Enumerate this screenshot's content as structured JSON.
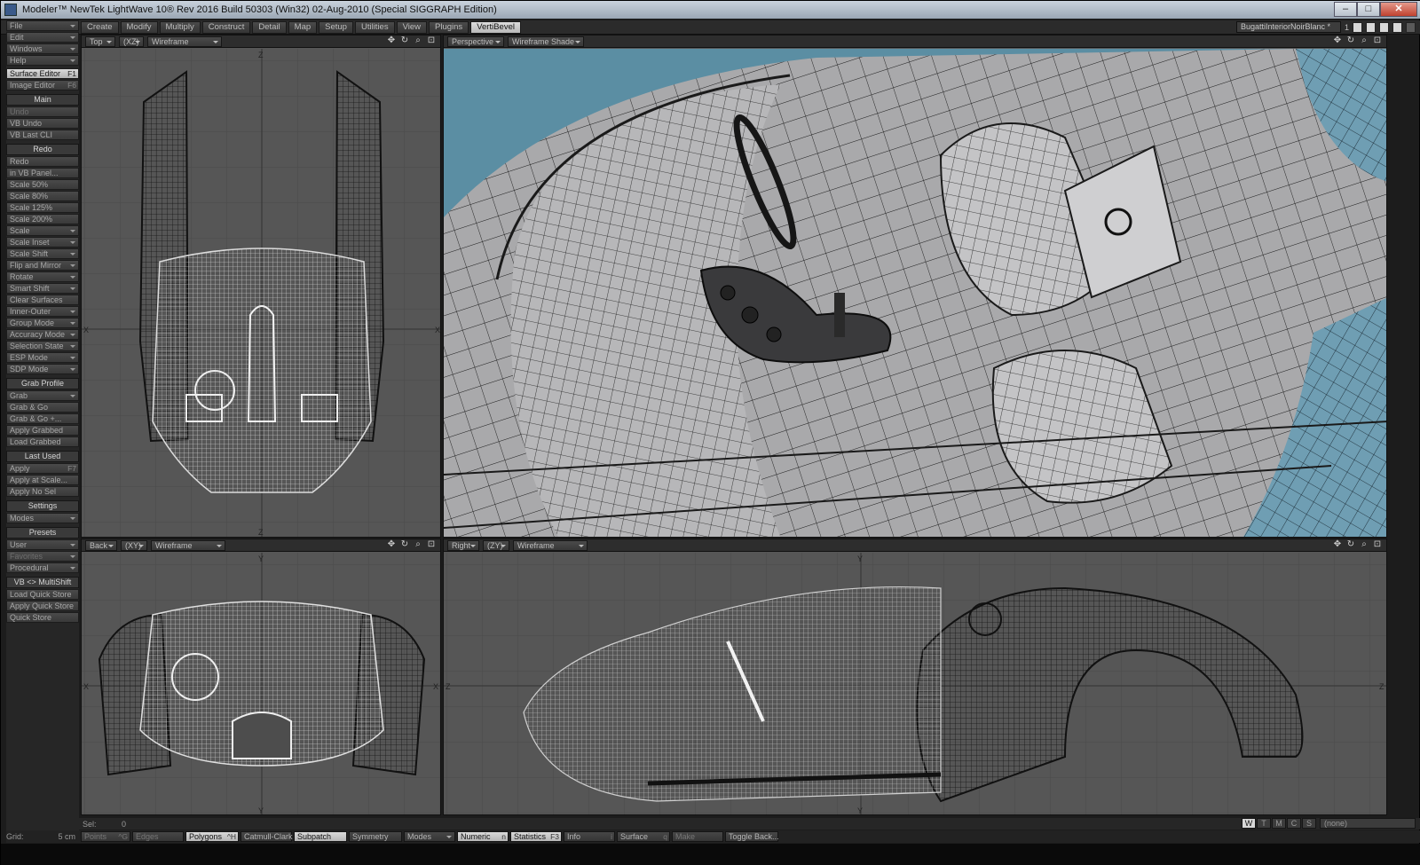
{
  "window": {
    "title": "Modeler™ NewTek LightWave 10® Rev 2016 Build 50303 (Win32) 02-Aug-2010 (Special SIGGRAPH Edition)",
    "minimize": "–",
    "maximize": "□",
    "close": "✕"
  },
  "tabs": [
    "Create",
    "Modify",
    "Multiply",
    "Construct",
    "Detail",
    "Map",
    "Setup",
    "Utilities",
    "View",
    "Plugins",
    "VertiBevel"
  ],
  "active_tab": "VertiBevel",
  "object_selector": "BugattiInteriorNoirBlanc *",
  "layer_number": "1",
  "sidebar": {
    "menus": [
      {
        "label": "File",
        "dd": true
      },
      {
        "label": "Edit",
        "dd": true
      },
      {
        "label": "Windows",
        "dd": true
      },
      {
        "label": "Help",
        "dd": true
      }
    ],
    "editors": [
      {
        "label": "Surface Editor",
        "key": "F1",
        "hl": true
      },
      {
        "label": "Image Editor",
        "key": "F6"
      }
    ],
    "main_head": "Main",
    "main": [
      {
        "label": "Undo",
        "dim": true
      },
      {
        "label": "VB Undo"
      },
      {
        "label": "VB Last CLI"
      }
    ],
    "redo_head": "Redo",
    "redo": [
      {
        "label": "Redo"
      },
      {
        "label": "in VB Panel..."
      },
      {
        "label": "Scale   50%"
      },
      {
        "label": "Scale   80%"
      },
      {
        "label": "Scale 125%"
      },
      {
        "label": "Scale 200%"
      },
      {
        "label": "Scale",
        "dd": true
      },
      {
        "label": "Scale Inset",
        "dd": true
      },
      {
        "label": "Scale Shift",
        "dd": true
      },
      {
        "label": "Flip and Mirror",
        "dd": true
      },
      {
        "label": "Rotate",
        "dd": true
      },
      {
        "label": "Smart Shift",
        "dd": true
      },
      {
        "label": "Clear Surfaces"
      },
      {
        "label": "Inner-Outer",
        "dd": true
      },
      {
        "label": "Group Mode",
        "dd": true
      },
      {
        "label": "Accuracy Mode",
        "dd": true
      },
      {
        "label": "Selection State",
        "dd": true
      },
      {
        "label": "ESP Mode",
        "dd": true
      },
      {
        "label": "SDP Mode",
        "dd": true
      }
    ],
    "grab_head": "Grab Profile",
    "grab": [
      {
        "label": "Grab",
        "dd": true
      },
      {
        "label": "Grab & Go"
      },
      {
        "label": "Grab & Go +..."
      },
      {
        "label": "Apply Grabbed"
      },
      {
        "label": "Load Grabbed"
      }
    ],
    "last_head": "Last Used",
    "last": [
      {
        "label": "Apply",
        "key": "F7"
      },
      {
        "label": "Apply at Scale..."
      },
      {
        "label": "Apply No Sel"
      }
    ],
    "settings_head": "Settings",
    "settings": [
      {
        "label": "Modes",
        "dd": true
      }
    ],
    "presets_head": "Presets",
    "presets": [
      {
        "label": "User",
        "dd": true
      },
      {
        "label": "Favorites",
        "dd": true,
        "dim": true
      },
      {
        "label": "Procedural",
        "dd": true
      }
    ],
    "multishift_head": "VB <> MultiShift",
    "multishift": [
      {
        "label": "Load Quick Store"
      },
      {
        "label": "Apply Quick Store"
      },
      {
        "label": "Quick Store"
      }
    ]
  },
  "viewports": {
    "top": {
      "view": "Top",
      "axes": "(XZ)",
      "mode": "Wireframe"
    },
    "perspective": {
      "view": "Perspective",
      "mode": "Wireframe Shade"
    },
    "back": {
      "view": "Back",
      "axes": "(XY)",
      "mode": "Wireframe"
    },
    "right": {
      "view": "Right",
      "axes": "(ZY)",
      "mode": "Wireframe"
    },
    "axis_x": "X",
    "axis_y": "Y",
    "axis_z": "Z"
  },
  "sel": {
    "label": "Sel:",
    "value": "0"
  },
  "wtmcs": [
    "W",
    "T",
    "M",
    "C",
    "S"
  ],
  "wtmcs_active": "W",
  "surface_none": "(none)",
  "status": {
    "grid_label": "Grid:",
    "grid_value": "5 cm",
    "items": [
      {
        "label": "Points",
        "key": "^G",
        "dim": true,
        "w": 56
      },
      {
        "label": "Edges",
        "dim": true,
        "w": 58
      },
      {
        "label": "Polygons",
        "key": "^H",
        "hl": true,
        "w": 60
      },
      {
        "label": "Catmull-Clark",
        "w": 58
      },
      {
        "label": "Subpatch",
        "hl": true,
        "w": 60
      },
      {
        "label": "Symmetry",
        "w": 60
      },
      {
        "label": "Modes",
        "dd": true,
        "w": 58
      },
      {
        "label": "Numeric",
        "key": "n",
        "hl": true,
        "w": 58
      },
      {
        "label": "Statistics",
        "key": "F3",
        "hl": true,
        "w": 58
      },
      {
        "label": "Info",
        "key": "i",
        "w": 58
      },
      {
        "label": "Surface",
        "key": "q",
        "w": 60
      },
      {
        "label": "Make",
        "dim": true,
        "w": 58
      },
      {
        "label": "Toggle Back...",
        "w": 60
      }
    ]
  },
  "colors": {
    "viewport_bg": "#565656",
    "perspective_sky": "#5b8ea3",
    "wire_dark": "#141414",
    "wire_light": "#e6e6e6",
    "active_button": "#cccccc"
  }
}
